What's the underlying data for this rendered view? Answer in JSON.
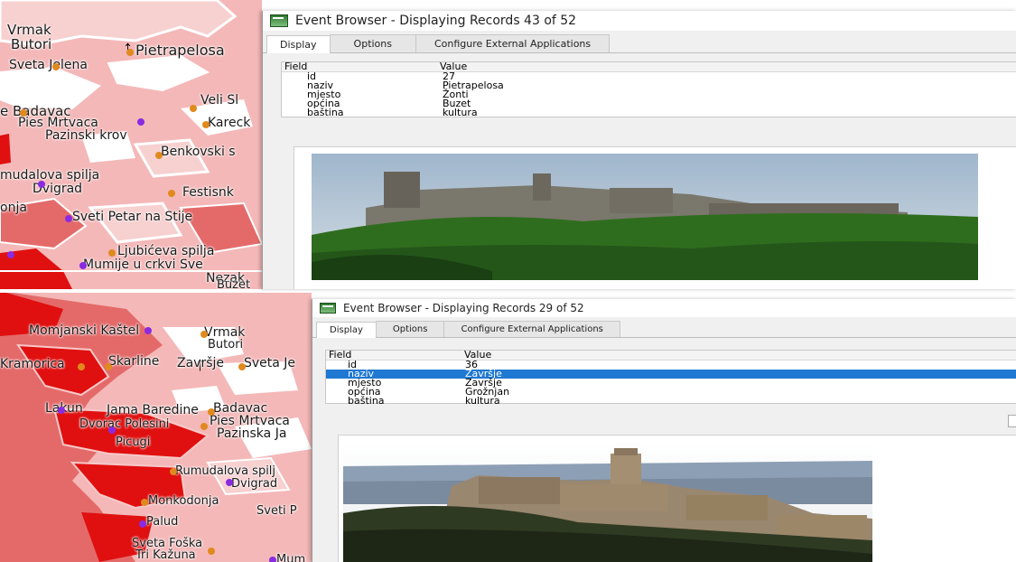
{
  "top": {
    "map_labels": [
      "Vrmak",
      "Butori",
      "Pietrapelosa",
      "Sveta Jelena",
      "Veli Sl",
      "e Badavac",
      "Pies Mrtvaca",
      "Pazinski krov",
      "Kareck",
      "Benkovski s",
      "mudalova spilja",
      "Dvigrad",
      "Festisnk",
      "onja",
      "Sveti Petar na Stije",
      "Ljubićeva spilja",
      "Mumije u crkvi Sve",
      "Nezak",
      "Buzet"
    ],
    "window": {
      "title": "Event Browser - Displaying Records 43 of 52",
      "tabs": [
        "Display",
        "Options",
        "Configure External Applications"
      ],
      "headers": {
        "field": "Field",
        "value": "Value"
      },
      "rows": [
        {
          "field": "id",
          "value": "27"
        },
        {
          "field": "naziv",
          "value": "Pietrapelosa"
        },
        {
          "field": "mjesto",
          "value": "Žonti"
        },
        {
          "field": "općina",
          "value": "Buzet"
        },
        {
          "field": "baština",
          "value": "kultura"
        }
      ],
      "photo_icon": "castle-ruin-photo"
    }
  },
  "bottom": {
    "map_labels": [
      "Momjanski Kaštel",
      "Vrmak",
      "Butori",
      "Kramorica",
      "Skarline",
      "Završje",
      "Sveta Je",
      "Lakun",
      "Jama Baredine",
      "Badavac",
      "Dvorac Polesini",
      "Pies Mrtvaca",
      "Picugi",
      "Pazinska Ja",
      "Rumudalova spilj",
      "Dvigrad",
      "Monkodonja",
      "Sveti P",
      "Palud",
      "Sveta Foška",
      "Tri Kažuna",
      "Mum"
    ],
    "window": {
      "title": "Event Browser - Displaying Records 29 of 52",
      "tabs": [
        "Display",
        "Options",
        "Configure External Applications"
      ],
      "headers": {
        "field": "Field",
        "value": "Value"
      },
      "rows": [
        {
          "field": "id",
          "value": "36"
        },
        {
          "field": "naziv",
          "value": "Završje",
          "selected": true
        },
        {
          "field": "mjesto",
          "value": "Završje"
        },
        {
          "field": "općina",
          "value": "Grožnjan"
        },
        {
          "field": "baština",
          "value": "kultura"
        }
      ],
      "photo_icon": "hilltop-village-photo"
    }
  },
  "colors": {
    "map_light": "#f4b8b8",
    "map_mid": "#e46a6a",
    "map_dark": "#e01010",
    "selection": "#1f78d1"
  }
}
